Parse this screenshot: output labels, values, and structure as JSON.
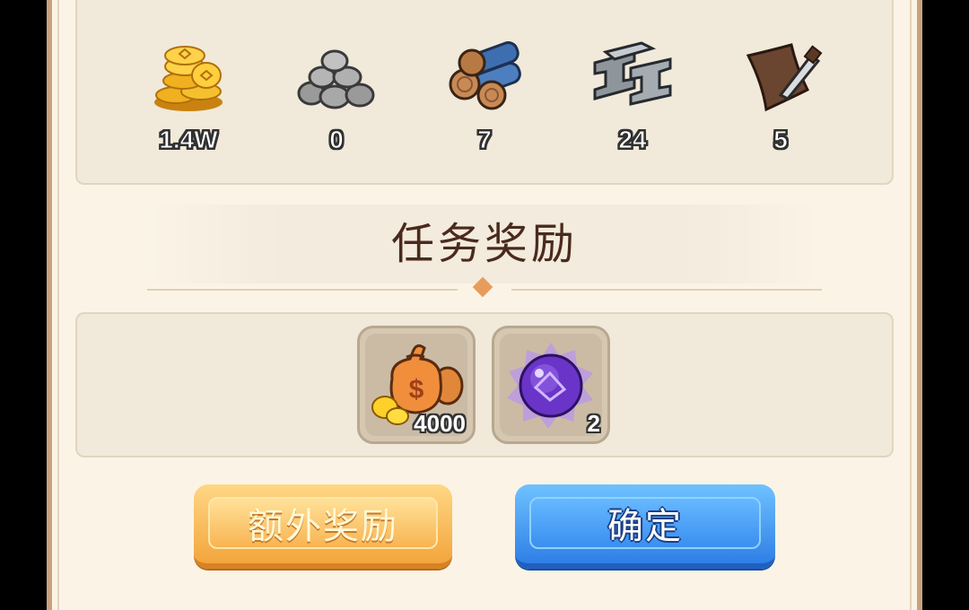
{
  "resources": [
    {
      "name": "coins-icon",
      "value": "1.4W"
    },
    {
      "name": "stone-icon",
      "value": "0"
    },
    {
      "name": "wood-icon",
      "value": "7"
    },
    {
      "name": "iron-icon",
      "value": "24"
    },
    {
      "name": "leather-icon",
      "value": "5"
    }
  ],
  "section_title": "任务奖励",
  "rewards": [
    {
      "name": "money-bag-icon",
      "count": "4000"
    },
    {
      "name": "purple-orb-icon",
      "count": "2"
    }
  ],
  "buttons": {
    "extra_label": "额外奖励",
    "confirm_label": "确定"
  },
  "colors": {
    "panel_bg": "#fbf4e6",
    "title": "#4a2a1e",
    "accent_orange": "#f3a53c",
    "accent_blue": "#2f7fe6"
  }
}
